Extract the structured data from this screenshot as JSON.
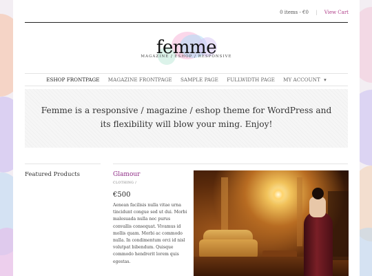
{
  "topbar": {
    "cart_count": "0 items - €0",
    "view_cart": "View Cart"
  },
  "logo": {
    "name": "femme",
    "tagline": "MAGAZINE / ESHOP / RESPONSIVE"
  },
  "nav": {
    "items": [
      "ESHOP FRONTPAGE",
      "MAGAZINE FRONTPAGE",
      "SAMPLE PAGE",
      "FULLWIDTH PAGE",
      "MY ACCOUNT"
    ],
    "dropdown_indicator": "▾"
  },
  "hero": {
    "line1": "Femme is a responsive / magazine / eshop theme for WordPress and",
    "line2": "its flexibility will blow your ming. Enjoy!"
  },
  "sidebar": {
    "title": "Featured Products"
  },
  "product": {
    "title": "Glamour",
    "category": "CLOTHING /",
    "price": "€500",
    "description": "Aenean facilisis nulla vitae urna tincidunt congue sed ut dui. Morbi malesuada nulla nec purus convallis consequat. Vivamus id mollis quam. Morbi ac commodo nulla. In condimentum orci id nisl volutpat bibendum. Quisque commodo hendrerit lorem quis egestas."
  },
  "colors": {
    "accent": "#b0408a",
    "product_title": "#8f2d86",
    "background": "#f3eef3"
  }
}
